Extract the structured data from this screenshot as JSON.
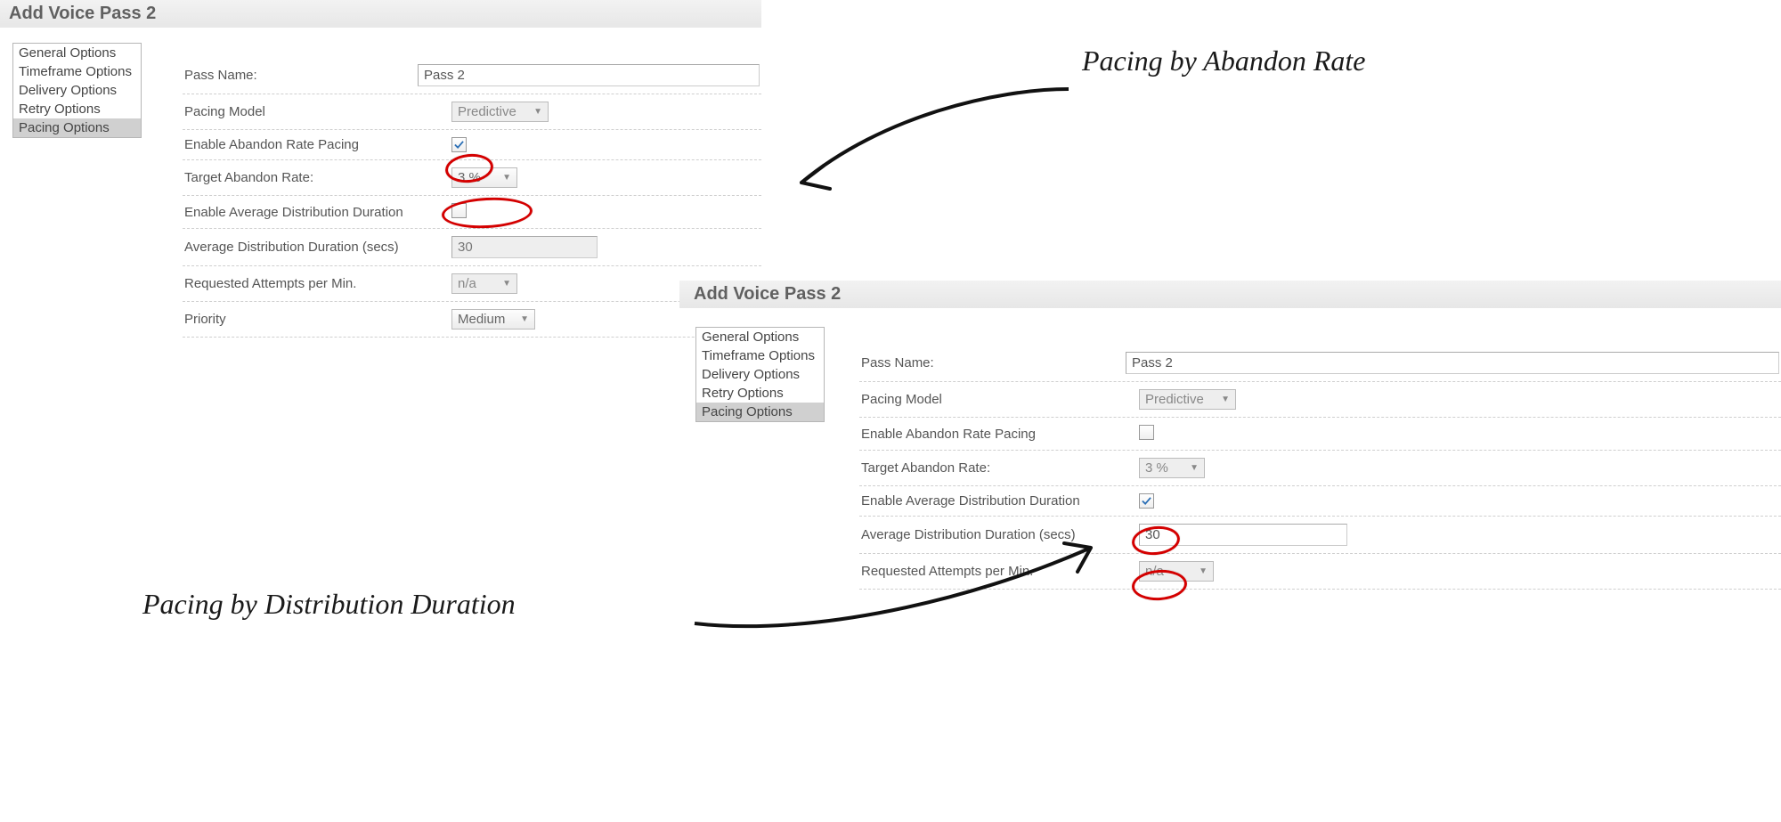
{
  "dialogA": {
    "title": "Add Voice Pass 2",
    "sidebar": {
      "items": [
        "General Options",
        "Timeframe Options",
        "Delivery Options",
        "Retry Options",
        "Pacing Options"
      ],
      "selected": 4
    },
    "form": {
      "pass_name_label": "Pass Name:",
      "pass_name_value": "Pass 2",
      "pacing_model_label": "Pacing Model",
      "pacing_model_value": "Predictive",
      "abandon_enable_label": "Enable Abandon Rate Pacing",
      "abandon_enable_checked": true,
      "abandon_target_label": "Target Abandon Rate:",
      "abandon_target_value": "3 %",
      "dist_enable_label": "Enable Average Distribution Duration",
      "dist_enable_checked": false,
      "dist_dur_label": "Average Distribution Duration (secs)",
      "dist_dur_value": "30",
      "req_att_label": "Requested Attempts per Min.",
      "req_att_value": "n/a",
      "priority_label": "Priority",
      "priority_value": "Medium"
    }
  },
  "dialogB": {
    "title": "Add Voice Pass 2",
    "sidebar": {
      "items": [
        "General Options",
        "Timeframe Options",
        "Delivery Options",
        "Retry Options",
        "Pacing Options"
      ],
      "selected": 4
    },
    "form": {
      "pass_name_label": "Pass Name:",
      "pass_name_value": "Pass 2",
      "pacing_model_label": "Pacing Model",
      "pacing_model_value": "Predictive",
      "abandon_enable_label": "Enable Abandon Rate Pacing",
      "abandon_enable_checked": false,
      "abandon_target_label": "Target Abandon Rate:",
      "abandon_target_value": "3 %",
      "dist_enable_label": "Enable Average Distribution Duration",
      "dist_enable_checked": true,
      "dist_dur_label": "Average Distribution Duration (secs)",
      "dist_dur_value": "30",
      "req_att_label": "Requested Attempts per Min.",
      "req_att_value": "n/a"
    }
  },
  "annotations": {
    "note_top": "Pacing by Abandon Rate",
    "note_bottom": "Pacing by Distribution Duration"
  }
}
